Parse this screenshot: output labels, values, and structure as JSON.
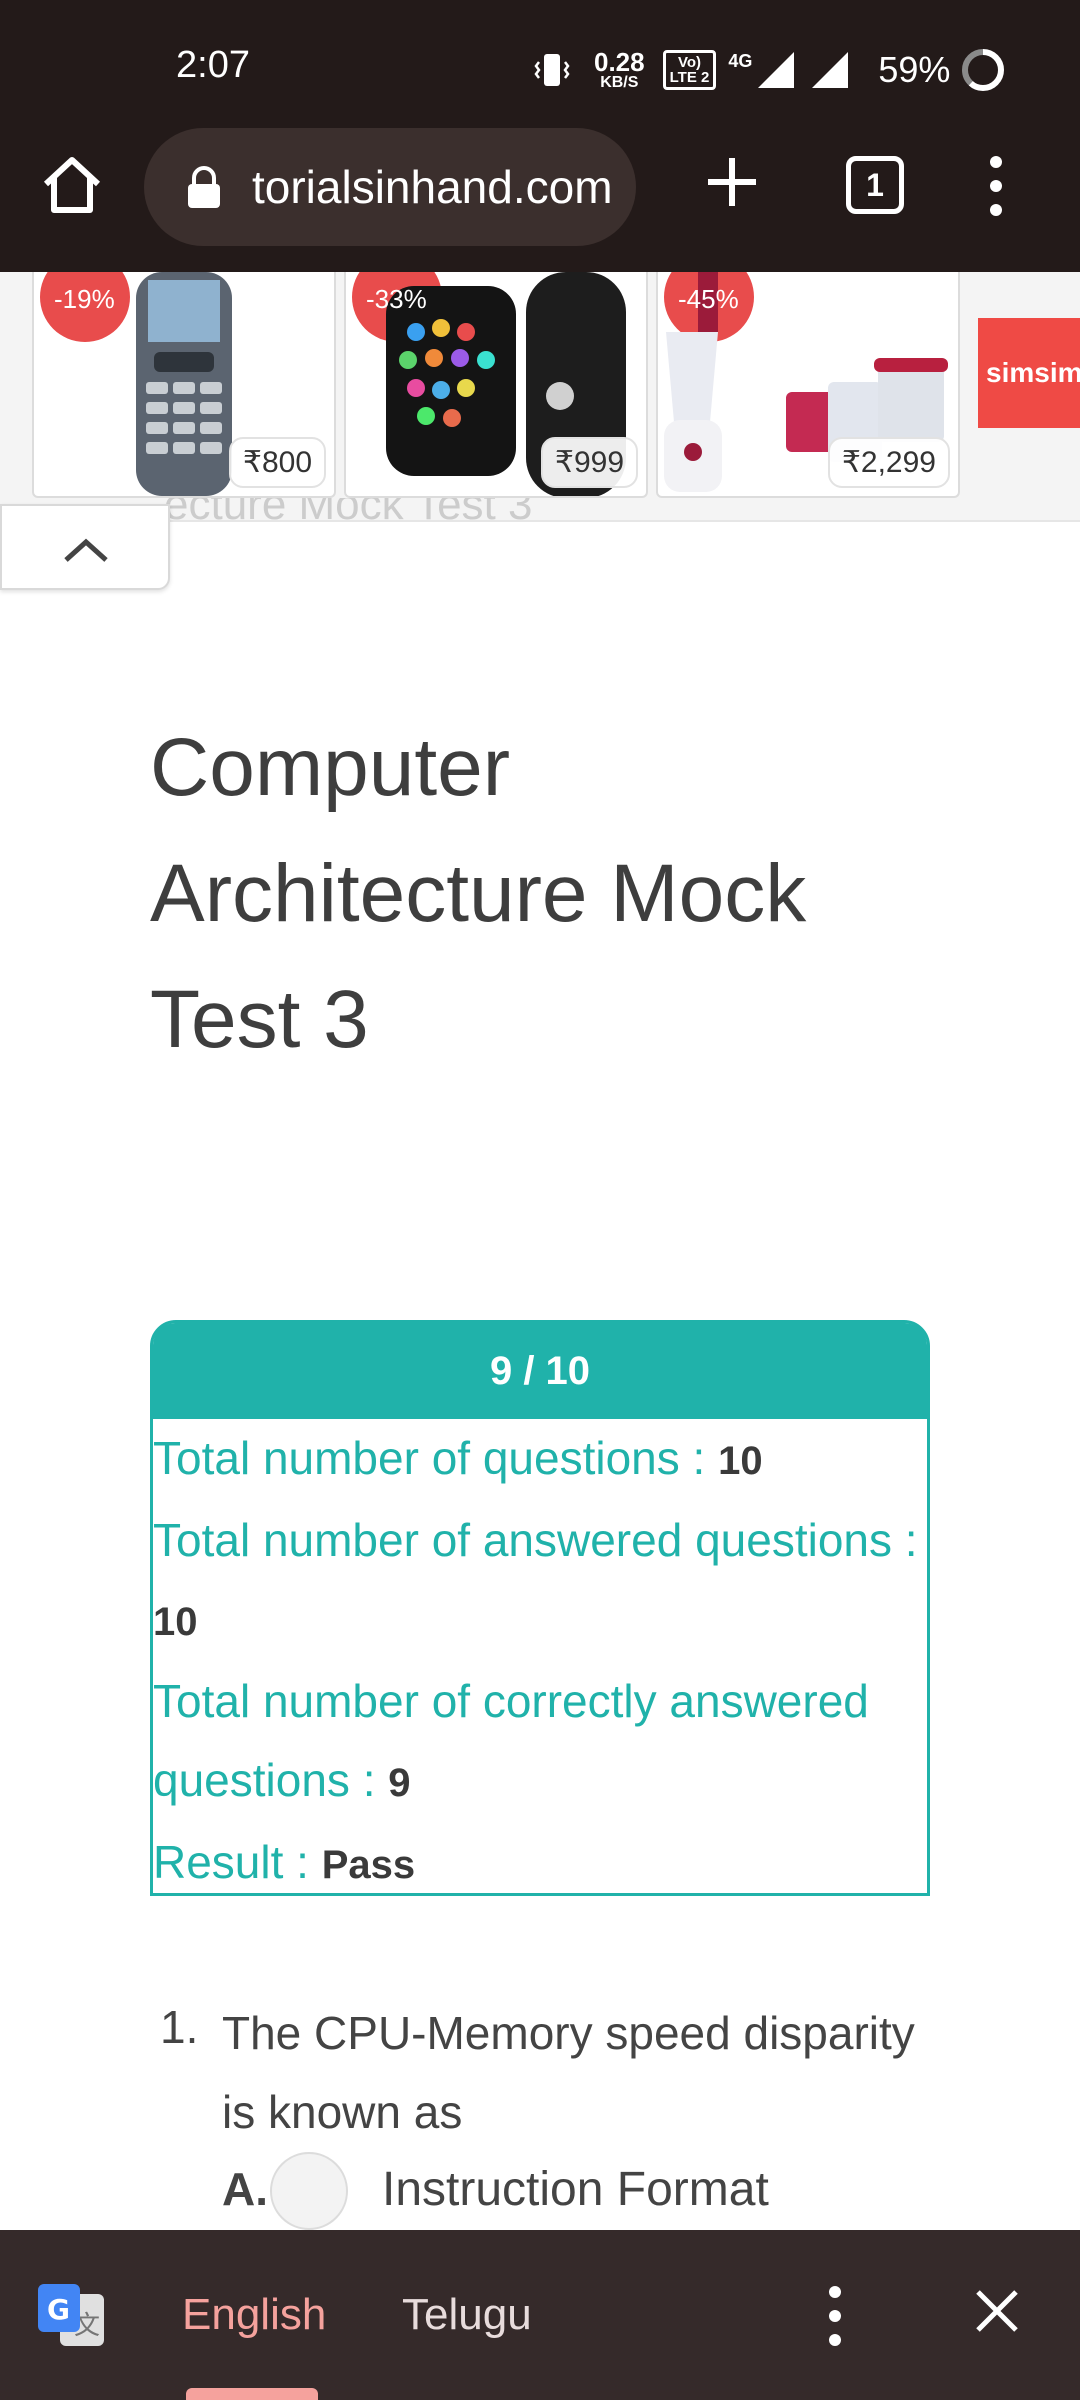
{
  "status_bar": {
    "time": "2:07",
    "speed_value": "0.28",
    "speed_unit": "KB/S",
    "volte_line1": "Vo)",
    "volte_line2": "LTE 2",
    "network": "4G",
    "battery": "59%"
  },
  "browser": {
    "url": "torialsinhand.com",
    "tab_count": "1"
  },
  "ads": {
    "products": [
      {
        "discount": "-19%",
        "price": "₹800",
        "icon": "feature-phone-image"
      },
      {
        "discount": "-33%",
        "price": "₹999",
        "icon": "smartwatch-image"
      },
      {
        "discount": "-45%",
        "price": "₹2,299",
        "icon": "mixer-grinder-image"
      }
    ],
    "brand": "simsim"
  },
  "ghost_title": "ecture Mock Test 3",
  "article": {
    "title": "Computer Architecture Mock Test 3"
  },
  "result": {
    "score": "9 / 10",
    "total_label": "Total number of questions : ",
    "total_value": "10",
    "answered_label": "Total number of answered questions : ",
    "answered_value": "10",
    "correct_label": "Total number of correctly answered questions : ",
    "correct_value": "9",
    "result_label": "Result : ",
    "result_value": "Pass"
  },
  "question": {
    "number": "1.",
    "text": "The CPU-Memory speed disparity is known as",
    "option_letter": "A.",
    "option_text": "Instruction Format"
  },
  "translate_bar": {
    "lang_selected": "English",
    "lang_other": "Telugu"
  },
  "colors": {
    "teal": "#20b2aa",
    "chrome_bg": "#231a19",
    "translate_bg": "#352a2a",
    "accent_pink": "#f5a29d"
  }
}
